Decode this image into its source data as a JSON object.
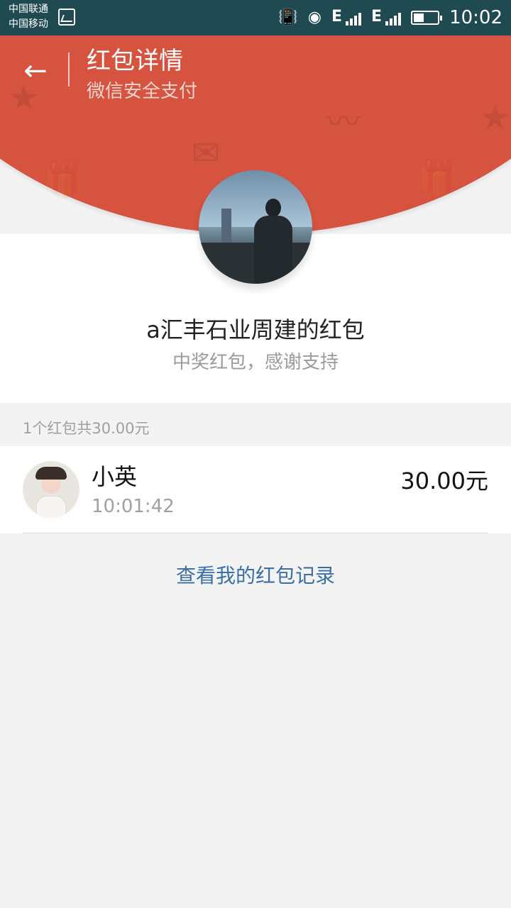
{
  "status_bar": {
    "carrier_1": "中国联通",
    "carrier_2": "中国移动",
    "network_1": "E",
    "network_2": "E",
    "time": "10:02",
    "icons": [
      "gallery-icon",
      "vibrate-icon",
      "wifi-icon",
      "signal-icon",
      "battery-icon"
    ]
  },
  "header": {
    "title": "红包详情",
    "subtitle": "微信安全支付",
    "back_icon": "arrow-left-icon",
    "background_color": "#d5533f"
  },
  "packet": {
    "sender_title": "a汇丰石业周建的红包",
    "wish": "中奖红包，感谢支持"
  },
  "summary": "1个红包共30.00元",
  "records": [
    {
      "name": "小英",
      "time": "10:01:42",
      "amount": "30.00元"
    }
  ],
  "footer": {
    "history_link": "查看我的红包记录",
    "link_color": "#3b6fa5"
  }
}
